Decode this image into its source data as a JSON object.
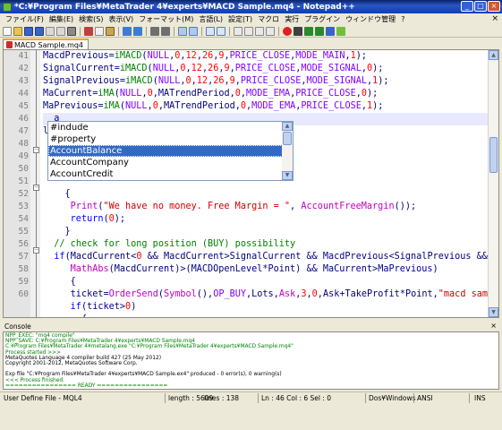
{
  "window": {
    "title": "*C:¥Program Files¥MetaTrader 4¥experts¥MACD Sample.mq4 - Notepad++",
    "minimize": "_",
    "maximize": "□",
    "close": "×"
  },
  "menu": {
    "items": [
      "ファイル(F)",
      "編集(E)",
      "検索(S)",
      "表示(V)",
      "フォーマット(M)",
      "言語(L)",
      "設定(T)",
      "マクロ",
      "実行",
      "プラグイン",
      "ウィンドウ管理",
      "?"
    ],
    "close": "×"
  },
  "tab": {
    "label": "MACD Sample.mq4"
  },
  "editor": {
    "line_numbers": [
      "41",
      "42",
      "43",
      "44",
      "45",
      "46",
      "47",
      "48",
      "49",
      "50",
      "51",
      "52",
      "53",
      "54",
      "55",
      "56",
      "57",
      "58",
      "59",
      "60"
    ],
    "current_line": "46"
  },
  "autocomplete": {
    "items": [
      "#indude",
      "#property",
      "AccountBalance",
      "AccountCompany",
      "AccountCredit"
    ],
    "selected": "AccountBalance"
  },
  "console": {
    "title": "Console",
    "close": "×",
    "lines": [
      "NPP_EXEC: \"mq4 compile\"",
      "NPP_SAVE: C:¥Program Files¥MetaTrader 4¥experts¥MACD Sample.mq4",
      "C:¥Program Files¥MetaTrader 4¥metalang.exe  \"C:¥Program Files¥MetaTrader 4¥experts¥MACD Sample.mq4\"",
      "Process started >>>",
      "MetaQuotes Language 4 compiler build 427 (25 May 2012)",
      "Copyright 2001-2012, MetaQuotes Software Corp.",
      "",
      "Exp file \"C:¥Program Files¥MetaTrader 4¥experts¥MACD Sample.ex4\" produced - 0 error(s), 0 warning(s)",
      "<<< Process finished.",
      "================ READY ================"
    ]
  },
  "statusbar": {
    "file_type": "User Define File - MQL4",
    "length": "length : 5609",
    "lines": "lines : 138",
    "position": "Ln : 46    Col : 6    Sel : 0",
    "eol": "Dos¥Windows",
    "encoding": "ANSI",
    "mode": "INS"
  },
  "colors": {
    "function": "#008000",
    "identifier": "#000080",
    "constant": "#8000ff",
    "number": "#ff0000",
    "keyword": "#0000ff",
    "selection": "#316ac5",
    "current_line": "#e8e8ff"
  }
}
